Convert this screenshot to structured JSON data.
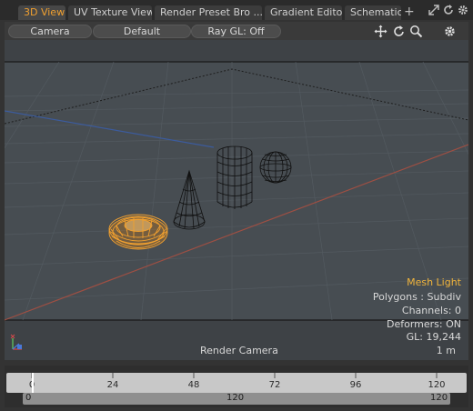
{
  "tabs": [
    {
      "label": "3D View",
      "active": true
    },
    {
      "label": "UV Texture View",
      "active": false
    },
    {
      "label": "Render Preset Bro ...",
      "active": false
    },
    {
      "label": "Gradient Editor",
      "active": false
    },
    {
      "label": "Schematic",
      "active": false
    }
  ],
  "tab_add_label": "+",
  "viewport_toolbar": {
    "camera_label": "Camera",
    "shading_label": "Default",
    "raygl_label": "Ray GL: Off"
  },
  "viewport_info": {
    "selection": "Mesh Light",
    "polygons": "Polygons : Subdiv",
    "channels": "Channels: 0",
    "deformers": "Deformers: ON",
    "gl": "GL: 19,244",
    "camera": "Render Camera",
    "grid_scale": "1 m"
  },
  "timeline": {
    "ticks": [
      "0",
      "24",
      "48",
      "72",
      "96",
      "120"
    ],
    "range_start": "0",
    "range_mid": "120",
    "range_end": "120"
  },
  "colors": {
    "accent": "#f0a030",
    "viewport_bg": "#474d52",
    "selection": "#f0a030"
  },
  "icons": [
    "maximize-icon",
    "refresh-icon",
    "settings-gear-icon",
    "move-view-icon",
    "rotate-view-icon",
    "zoom-icon",
    "viewport-settings-icon",
    "axis-icon"
  ]
}
